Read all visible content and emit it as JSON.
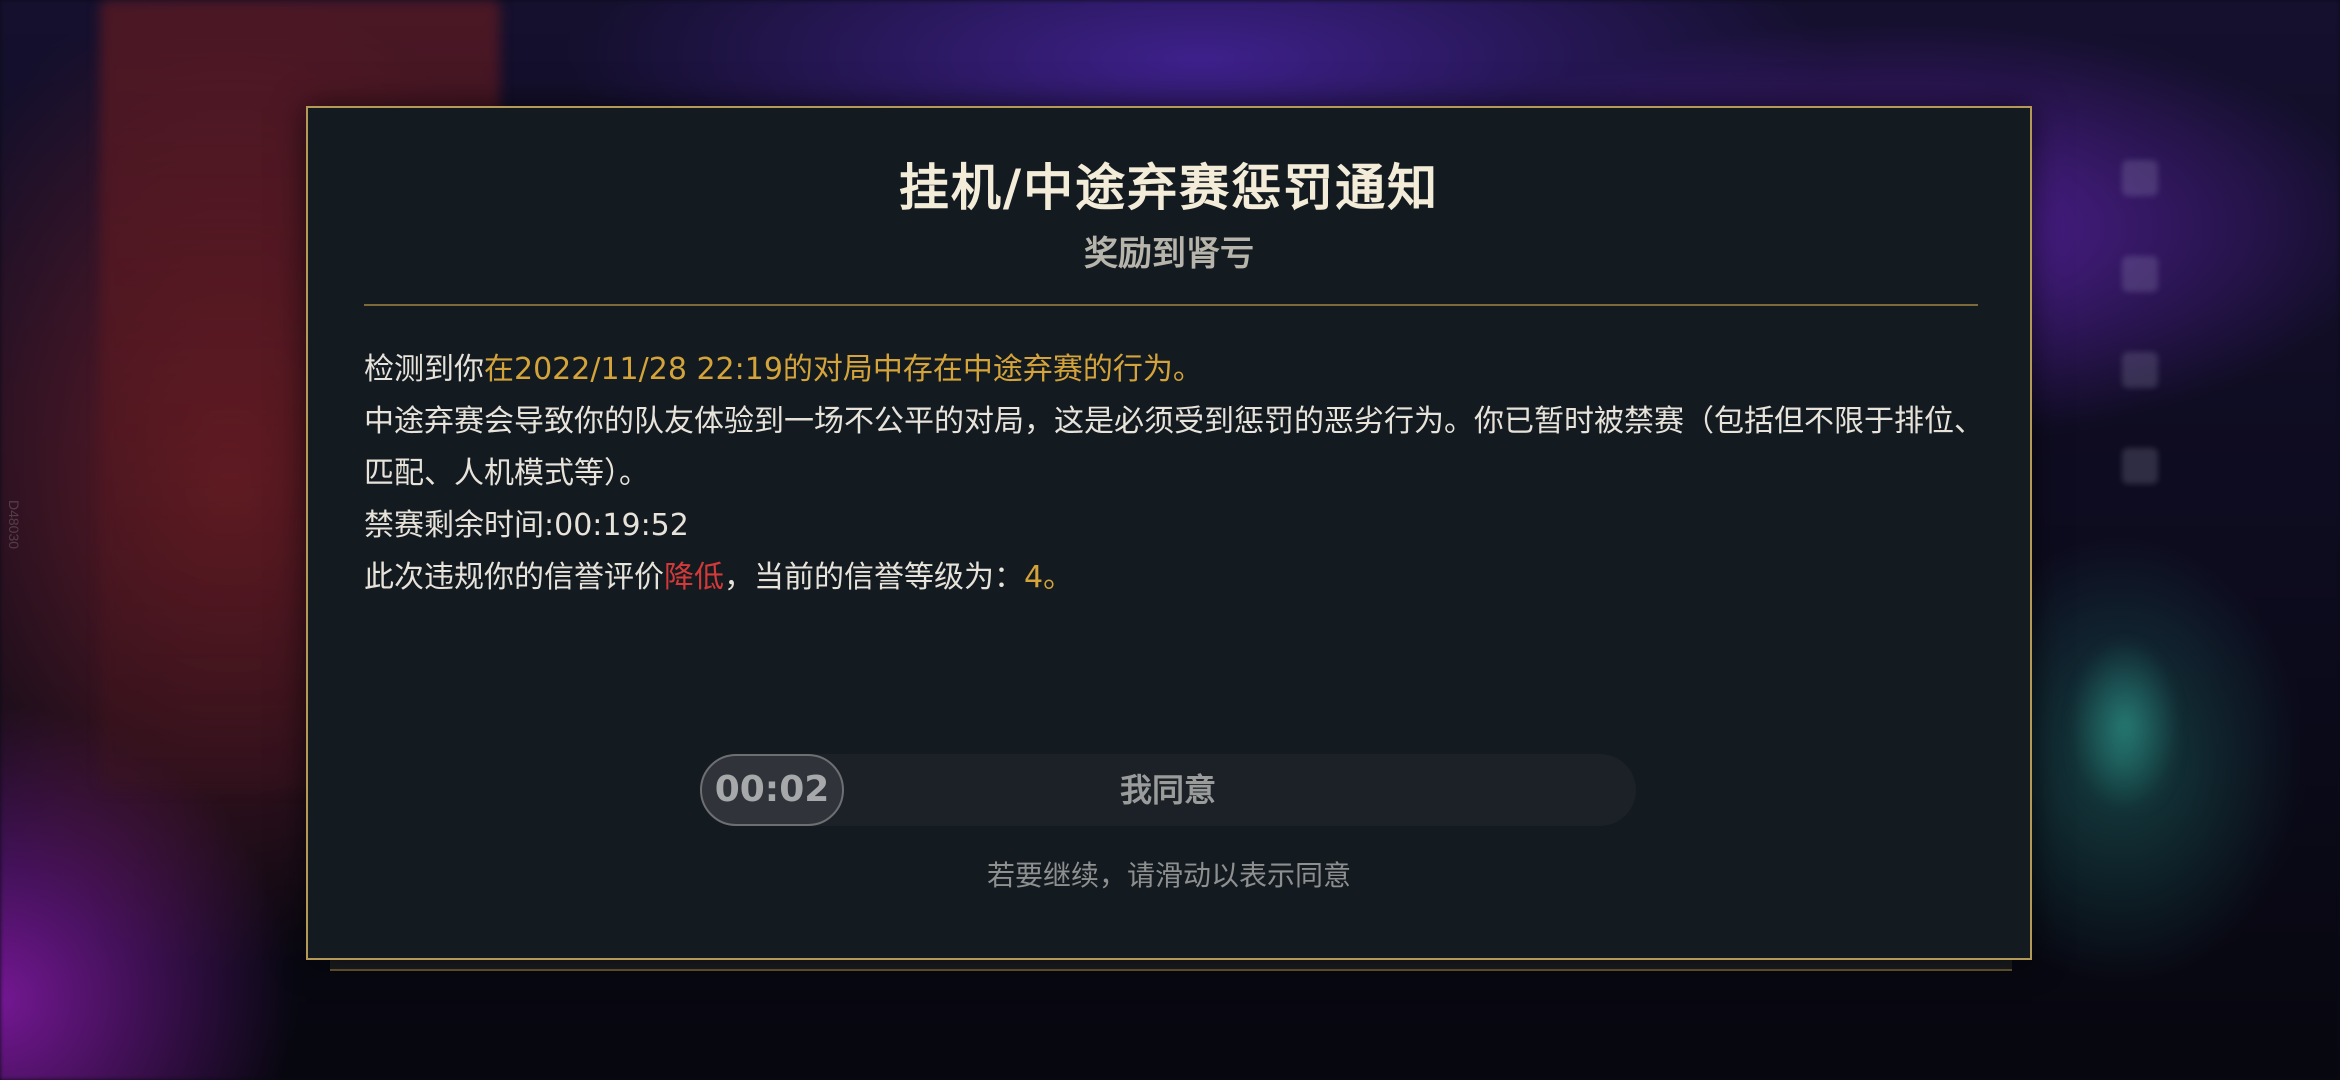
{
  "background": {
    "watermark": "D48030"
  },
  "dialog": {
    "title": "挂机/中途弃赛惩罚通知",
    "subtitle": "奖励到肾亏",
    "line1_prefix": "检测到你",
    "line1_highlight": "在2022/11/28 22:19的对局中存在中途弃赛的行为。",
    "line2": "中途弃赛会导致你的队友体验到一场不公平的对局，这是必须受到惩罚的恶劣行为。你已暂时被禁赛（包括但不限于排位、匹配、人机模式等）。",
    "ban_label": "禁赛剩余时间:",
    "ban_time": "00:19:52",
    "rating_prefix": "此次违规你的信誉评价",
    "rating_change": "降低",
    "rating_middle": "，当前的信誉等级为：",
    "rating_level": "4",
    "rating_suffix": "。",
    "slider": {
      "countdown": "00:02",
      "label": "我同意"
    },
    "hint": "若要继续，请滑动以表示同意"
  },
  "colors": {
    "accent_gold": "#d4a43a",
    "warning_red": "#d23a3a",
    "border_gold": "#b59a57",
    "panel_bg": "#131a20"
  }
}
